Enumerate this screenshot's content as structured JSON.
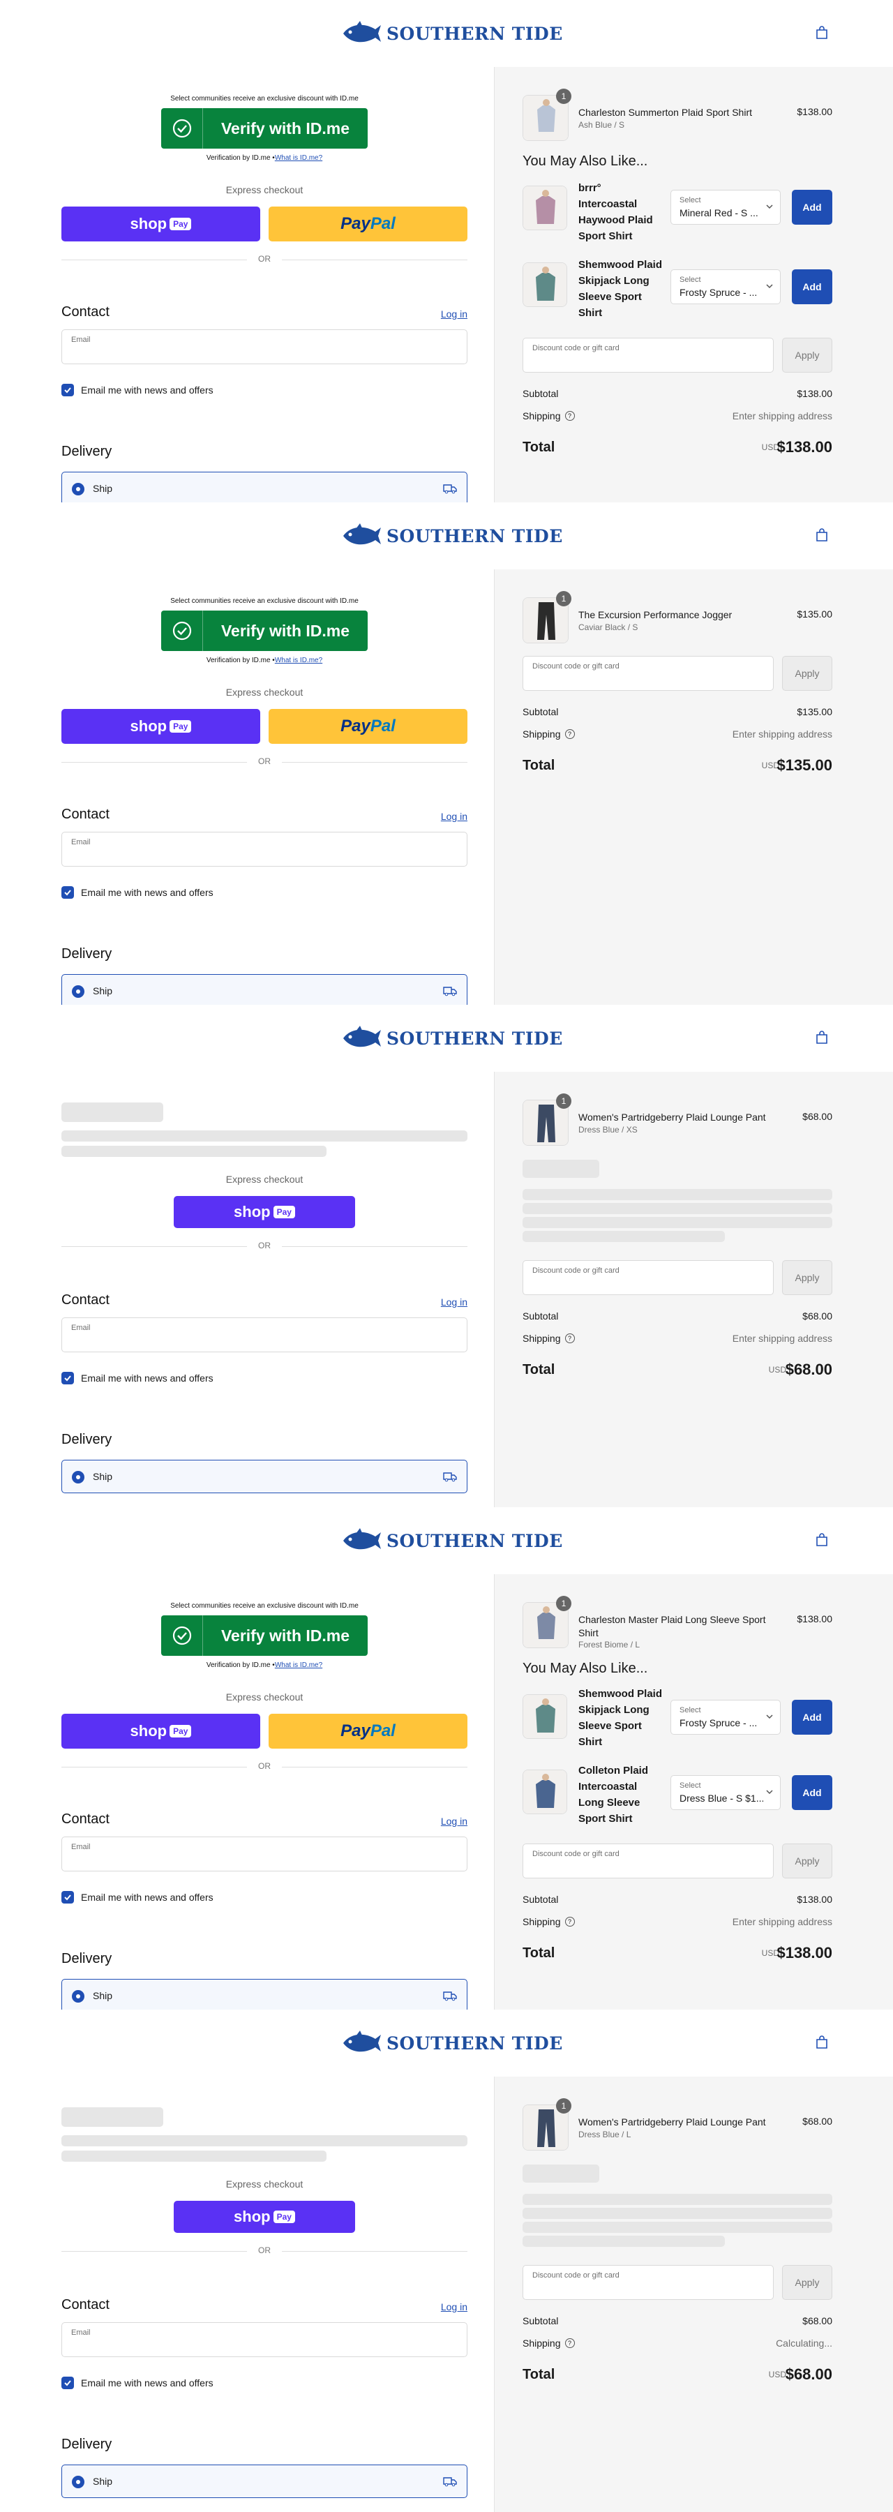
{
  "brand": {
    "name": "SOUTHERN TIDE",
    "accent": "#1f4eb4",
    "logo_color": "#1f4e9e"
  },
  "common": {
    "idme_top": "Select communities receive an exclusive discount with ID.me",
    "idme_button": "Verify with ID.me",
    "idme_bottom_text": "Verification by ID.me •",
    "idme_bottom_link": "What is ID.me?",
    "express_checkout": "Express checkout",
    "shop_label": "shop",
    "shop_badge": "Pay",
    "paypal_1": "Pay",
    "paypal_2": "Pal",
    "or": "OR",
    "contact": "Contact",
    "login": "Log in",
    "email_placeholder": "Email",
    "news_label": "Email me with news and offers",
    "delivery": "Delivery",
    "ship": "Ship",
    "you_may_also_like": "You May Also Like...",
    "discount_placeholder": "Discount code or gift card",
    "apply": "Apply",
    "subtotal": "Subtotal",
    "shipping": "Shipping",
    "total": "Total",
    "currency": "USD",
    "select_label": "Select",
    "add": "Add"
  },
  "panels": [
    {
      "item": {
        "qty": "1",
        "name": "Charleston Summerton Plaid Sport Shirt",
        "variant": "Ash Blue / S",
        "price": "$138.00"
      },
      "upsells": [
        {
          "name": "brrr° Intercoastal Haywood Plaid Sport Shirt",
          "selected": "Mineral Red - S ..."
        },
        {
          "name": "Shemwood Plaid Skipjack Long Sleeve Sport Shirt",
          "selected": "Frosty Spruce - ..."
        }
      ],
      "subtotal": "$138.00",
      "shipping_value": "Enter shipping address",
      "total": "$138.00"
    },
    {
      "item": {
        "qty": "1",
        "name": "The Excursion Performance Jogger",
        "variant": "Caviar Black / S",
        "price": "$135.00"
      },
      "subtotal": "$135.00",
      "shipping_value": "Enter shipping address",
      "total": "$135.00"
    },
    {
      "item": {
        "qty": "1",
        "name": "Women's Partridgeberry Plaid Lounge Pant",
        "variant": "Dress Blue / XS",
        "price": "$68.00"
      },
      "subtotal": "$68.00",
      "shipping_value": "Enter shipping address",
      "total": "$68.00"
    },
    {
      "item": {
        "qty": "1",
        "name": "Charleston Master Plaid Long Sleeve Sport Shirt",
        "variant": "Forest Biome / L",
        "price": "$138.00"
      },
      "upsells": [
        {
          "name": "Shemwood Plaid Skipjack Long Sleeve Sport Shirt",
          "selected": "Frosty Spruce - ..."
        },
        {
          "name": "Colleton Plaid Intercoastal Long Sleeve Sport Shirt",
          "selected": "Dress Blue - S $1..."
        }
      ],
      "subtotal": "$138.00",
      "shipping_value": "Enter shipping address",
      "total": "$138.00"
    },
    {
      "item": {
        "qty": "1",
        "name": "Women's Partridgeberry Plaid Lounge Pant",
        "variant": "Dress Blue / L",
        "price": "$68.00"
      },
      "subtotal": "$68.00",
      "shipping_value": "Calculating...",
      "total": "$68.00"
    }
  ]
}
